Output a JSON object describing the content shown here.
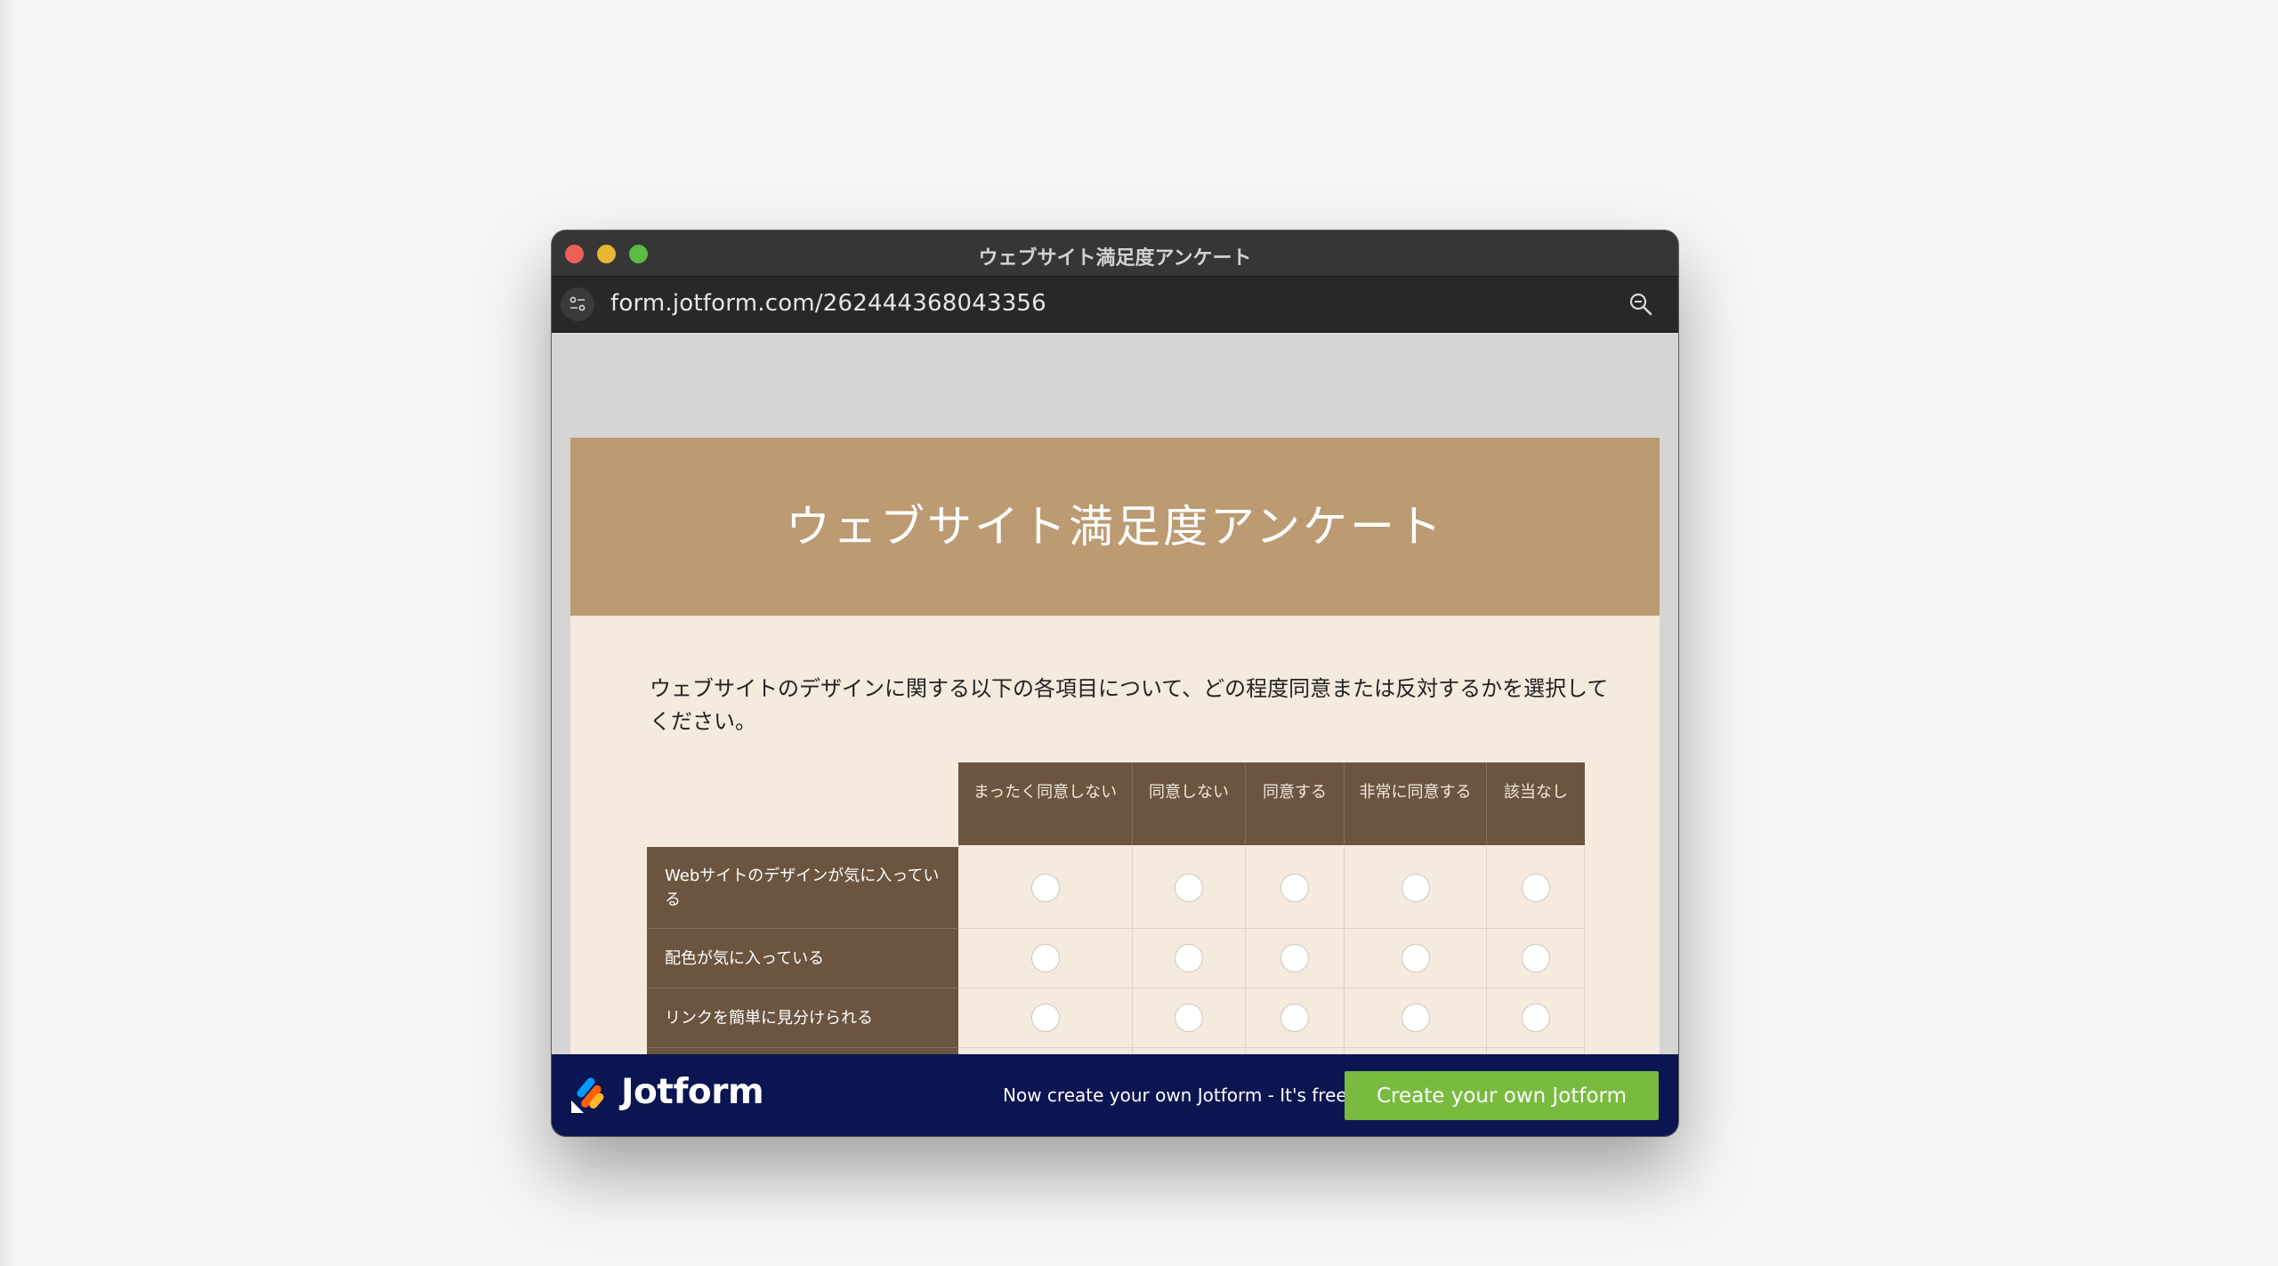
{
  "window": {
    "title": "ウェブサイト満足度アンケート"
  },
  "browser": {
    "url": "form.jotform.com/262444368043356",
    "site_settings_icon": "sliders-icon",
    "zoom_icon": "magnifier-icon"
  },
  "form": {
    "title": "ウェブサイト満足度アンケート",
    "instructions": "ウェブサイトのデザインに関する以下の各項目について、どの程度同意または反対するかを選択してください。",
    "columns": [
      {
        "label": "まったく同意しない"
      },
      {
        "label": "同意しない"
      },
      {
        "label": "同意する"
      },
      {
        "label": "非常に同意する"
      },
      {
        "label": "該当なし"
      }
    ],
    "rows": [
      {
        "label": "Webサイトのデザインが気に入っている"
      },
      {
        "label": "配色が気に入っている"
      },
      {
        "label": "リンクを簡単に見分けられる"
      }
    ],
    "colors": {
      "header_bg": "#bc9a72",
      "body_bg": "#f5eade",
      "matrix_header_bg": "#6b5440"
    }
  },
  "banner": {
    "brand": "Jotform",
    "tagline": "Now create your own Jotform - It's free!",
    "cta_label": "Create your own Jotform",
    "colors": {
      "bg": "#0a1551",
      "cta": "#78bb3f"
    }
  }
}
